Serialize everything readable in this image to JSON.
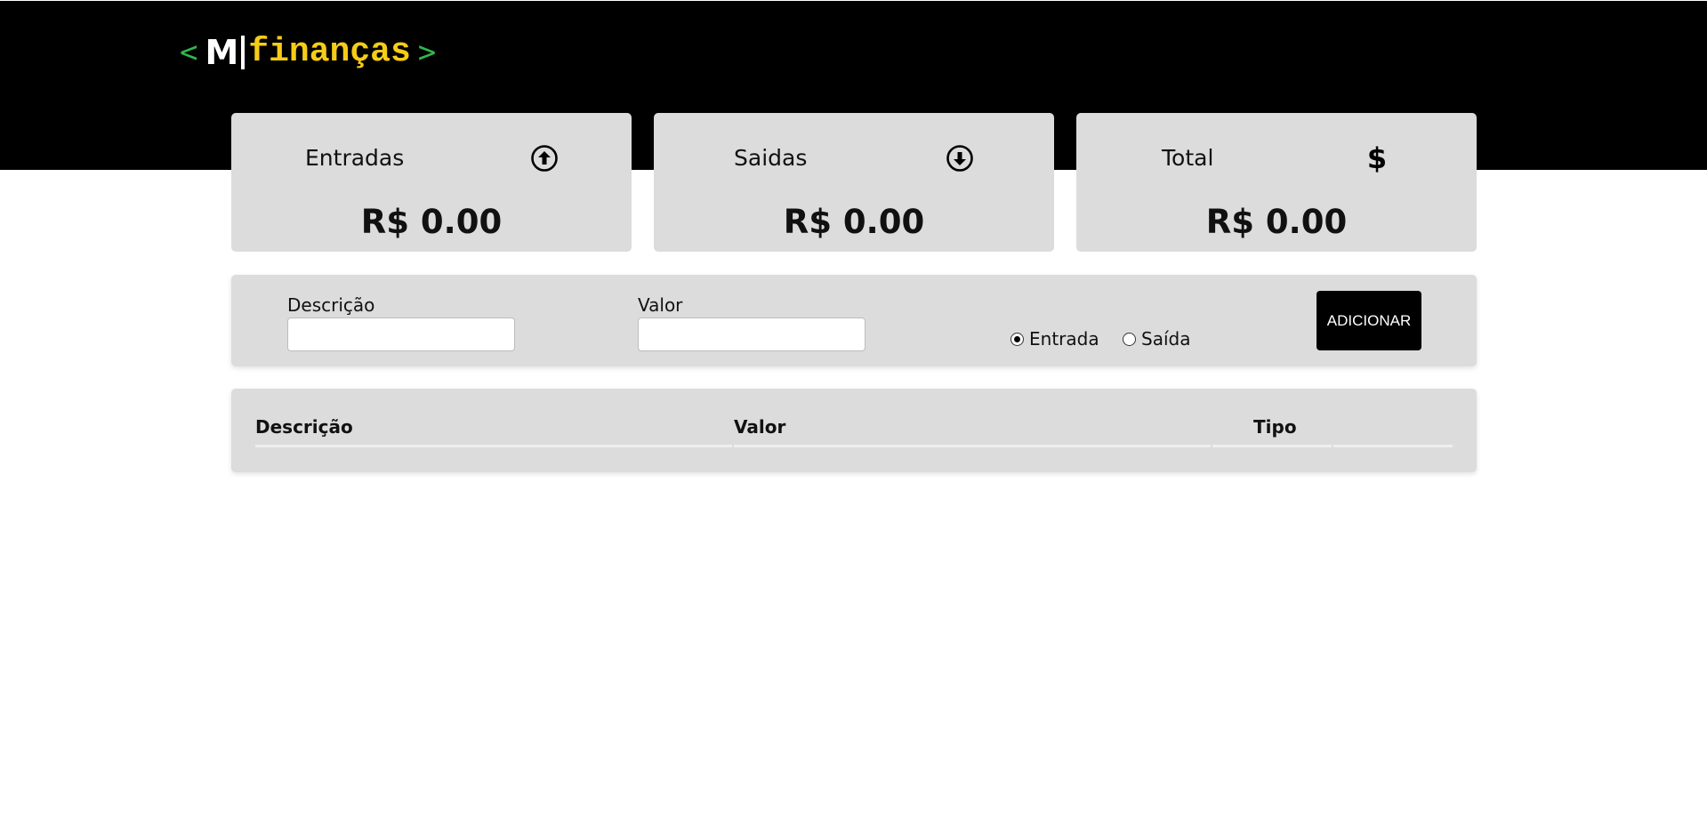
{
  "header": {
    "logo": {
      "bracket_left": "<",
      "letter": "M",
      "word": "finanças",
      "bracket_right": ">",
      "colors": {
        "bracket": "#2fb84a",
        "letter": "#ffffff",
        "word": "#f5cc16"
      }
    }
  },
  "summary": {
    "entradas": {
      "label": "Entradas",
      "icon": "arrow-up-circle-icon",
      "amount": "R$ 0.00"
    },
    "saidas": {
      "label": "Saidas",
      "icon": "arrow-down-circle-icon",
      "amount": "R$ 0.00"
    },
    "total": {
      "label": "Total",
      "icon": "dollar-icon",
      "icon_glyph": "$",
      "amount": "R$ 0.00"
    }
  },
  "form": {
    "descricao_label": "Descrição",
    "descricao_value": "",
    "valor_label": "Valor",
    "valor_value": "",
    "radio_options": [
      {
        "label": "Entrada",
        "checked": true
      },
      {
        "label": "Saída",
        "checked": false
      }
    ],
    "add_label": "ADICIONAR"
  },
  "table": {
    "columns": [
      "Descrição",
      "Valor",
      "Tipo",
      ""
    ],
    "rows": []
  },
  "colors": {
    "header_bg": "#000000",
    "card_bg": "#dcdcdc",
    "button_bg": "#000000"
  }
}
